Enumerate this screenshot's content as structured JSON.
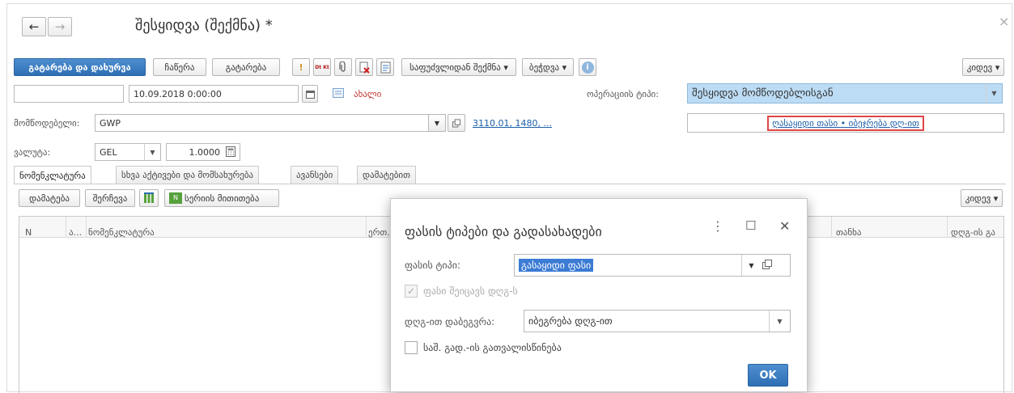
{
  "window": {
    "title": "შესყიდვა (შექმნა) *",
    "back_glyph": "←",
    "forward_glyph": "→",
    "close_glyph": "×"
  },
  "toolbar": {
    "post_close": "გატარება და დახურვა",
    "save": "ჩაწერა",
    "post": "გატარება",
    "exclaim": "!",
    "dtkt": "Dt Kt",
    "related_docs": "საფუძვლიდან შექმნა ▾",
    "print": "ბეჭდვა ▾",
    "info": "i",
    "more": "კიდევ ▾"
  },
  "header": {
    "number_value": "",
    "date_value": "10.09.2018 0:00:00",
    "new_label": "ახალი",
    "operation_type_label": "ოპერაციის ტიპი:",
    "operation_type_value": "შესყიდვა მომწოდებლისგან",
    "supplier_label": "მომწოდებელი:",
    "supplier_value": "GWP",
    "contract_link": "3110.01, 1480, ...",
    "vat_link": "ღასაყიდი თასი • იბეჯრება დღ-ით",
    "currency_label": "ვალუტა:",
    "currency_value": "GEL",
    "rate_value": "1.0000"
  },
  "tabs": [
    "ნომენკლატურა",
    "სხვა აქტივები და მომსახურება",
    "ავანსები",
    "დამატებით"
  ],
  "table_toolbar": {
    "add": "დამატება",
    "select": "შერჩევა",
    "serial": "სერიის მითითება",
    "more": "კიდევ ▾"
  },
  "columns": {
    "n": "N",
    "art": "ა...",
    "nomenclature": "ნომენკლატურა",
    "unit": "ერთ.",
    "sum": "თანხა",
    "vat": "დღგ-ის გა"
  },
  "dialog": {
    "title": "ფასის ტიპები და გადასახადები",
    "menu_glyph": "⋮",
    "max_glyph": "☐",
    "close_glyph": "✕",
    "price_type_label": "ფასის ტიპი:",
    "price_type_value": "გასაყიდი ფასი",
    "includes_vat_label": "ფასი შეიცავს დღგ-ს",
    "includes_vat_checked": true,
    "vat_taxation_label": "დღგ-ით დაბეგვრა:",
    "vat_taxation_value": "იბეგრება დღგ-ით",
    "consider_label": "საშ. გად.-ის გათვალისწინება",
    "consider_checked": false,
    "ok": "OK"
  },
  "colors": {
    "accent": "#2d6fb4",
    "selected_field": "#bcdcf5",
    "highlight_border": "#e04545"
  }
}
